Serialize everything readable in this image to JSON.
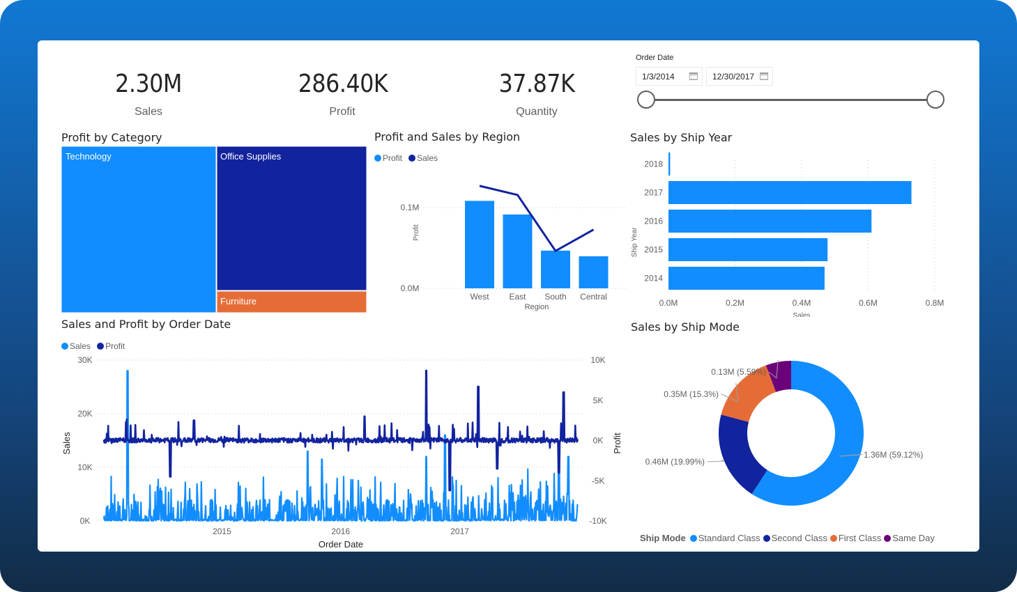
{
  "kpis": [
    {
      "value": "2.30M",
      "label": "Sales"
    },
    {
      "value": "286.40K",
      "label": "Profit"
    },
    {
      "value": "37.87K",
      "label": "Quantity"
    }
  ],
  "slicer": {
    "label": "Order Date",
    "start_date": "1/3/2014",
    "end_date": "12/30/2017",
    "range_start_fraction": 0.0,
    "range_end_fraction": 1.0
  },
  "colors": {
    "light_blue": "#118dff",
    "dark_blue": "#12239e",
    "orange": "#e66c37",
    "purple": "#6b007b",
    "grid": "#c8c6c4",
    "axis_text": "#605e5c"
  },
  "chart_data": [
    {
      "id": "profit_by_category",
      "type": "treemap",
      "title": "Profit by Category",
      "categories": [
        "Technology",
        "Office Supplies",
        "Furniture"
      ],
      "values": [
        145455,
        122491,
        18451
      ],
      "colors": [
        "#118dff",
        "#12239e",
        "#e66c37"
      ]
    },
    {
      "id": "profit_sales_by_region",
      "type": "bar",
      "title": "Profit and Sales by Region",
      "xlabel": "Region",
      "ylabel": "Profit",
      "y2label": "Sales",
      "categories": [
        "West",
        "East",
        "South",
        "Central"
      ],
      "series": [
        {
          "name": "Profit",
          "kind": "bar",
          "axis": "left",
          "color": "#118dff",
          "values": [
            108418,
            91523,
            46749,
            39706
          ]
        },
        {
          "name": "Sales",
          "kind": "line",
          "axis": "right",
          "color": "#12239e",
          "values": [
            725458,
            678781,
            391722,
            501240
          ]
        }
      ],
      "ylim": [
        0,
        0.145
      ],
      "y_ticks": [
        "0.0M",
        "0.1M"
      ],
      "y_tick_values": [
        0,
        0.1
      ],
      "y2lim": [
        0.2,
        0.8
      ],
      "y2_ticks": [
        "0.2M",
        "0.4M",
        "0.6M",
        "0.8M"
      ],
      "y2_tick_values": [
        0.2,
        0.4,
        0.6,
        0.8
      ],
      "legend": "top-left",
      "grid": true
    },
    {
      "id": "sales_by_ship_year",
      "type": "bar",
      "orientation": "horizontal",
      "title": "Sales by Ship Year",
      "xlabel": "Sales",
      "ylabel": "Ship Year",
      "categories": [
        "2018",
        "2017",
        "2016",
        "2015",
        "2014"
      ],
      "values": [
        0.005,
        0.73,
        0.61,
        0.478,
        0.469
      ],
      "xlim": [
        0,
        0.8
      ],
      "x_ticks": [
        "0.0M",
        "0.2M",
        "0.4M",
        "0.6M",
        "0.8M"
      ],
      "x_tick_values": [
        0,
        0.2,
        0.4,
        0.6,
        0.8
      ],
      "grid": true
    },
    {
      "id": "sales_profit_by_order_date",
      "type": "line",
      "title": "Sales and Profit by Order Date",
      "xlabel": "Order Date",
      "ylabel": "Sales",
      "y2label": "Profit",
      "x_range": [
        "2014-01-03",
        "2017-12-30"
      ],
      "x_ticks": [
        "2015",
        "2016",
        "2017"
      ],
      "ylim": [
        0,
        30000
      ],
      "y_ticks": [
        "0K",
        "10K",
        "20K",
        "30K"
      ],
      "y_tick_values": [
        0,
        10000,
        20000,
        30000
      ],
      "y2lim": [
        -10000,
        10000
      ],
      "y2_ticks": [
        "-10K",
        "-5K",
        "0K",
        "5K",
        "10K"
      ],
      "y2_tick_values": [
        -10000,
        -5000,
        0,
        5000,
        10000
      ],
      "legend": "top-left",
      "grid": true,
      "series": [
        {
          "name": "Sales",
          "axis": "left",
          "color": "#118dff",
          "peaks": [
            [
              0.05,
              28000
            ],
            [
              0.43,
              13000
            ],
            [
              0.46,
              11500
            ],
            [
              0.68,
              12000
            ],
            [
              0.72,
              16000
            ],
            [
              0.98,
              12000
            ],
            [
              0.96,
              13000
            ]
          ],
          "baseline_mean": 2000
        },
        {
          "name": "Profit",
          "axis": "right",
          "color": "#12239e",
          "peaks": [
            [
              0.14,
              -4500
            ],
            [
              0.19,
              2500
            ],
            [
              0.55,
              3000
            ],
            [
              0.68,
              8700
            ],
            [
              0.73,
              -6200
            ],
            [
              0.79,
              6700
            ],
            [
              0.83,
              -3500
            ],
            [
              0.97,
              6000
            ],
            [
              0.96,
              -4000
            ]
          ],
          "baseline_mean": 0
        }
      ]
    },
    {
      "id": "sales_by_ship_mode",
      "type": "pie",
      "donut": true,
      "title": "Sales by Ship Mode",
      "legend_title": "Ship Mode",
      "legend": "bottom",
      "categories": [
        "Standard Class",
        "Second Class",
        "First Class",
        "Same Day"
      ],
      "values": [
        1.36,
        0.46,
        0.35,
        0.13
      ],
      "percents": [
        59.12,
        19.99,
        15.3,
        5.59
      ],
      "labels": [
        "1.36M (59.12%)",
        "0.46M (19.99%)",
        "0.35M (15.3%)",
        "0.13M (5.59%)"
      ],
      "colors": [
        "#118dff",
        "#12239e",
        "#e66c37",
        "#6b007b"
      ]
    }
  ]
}
